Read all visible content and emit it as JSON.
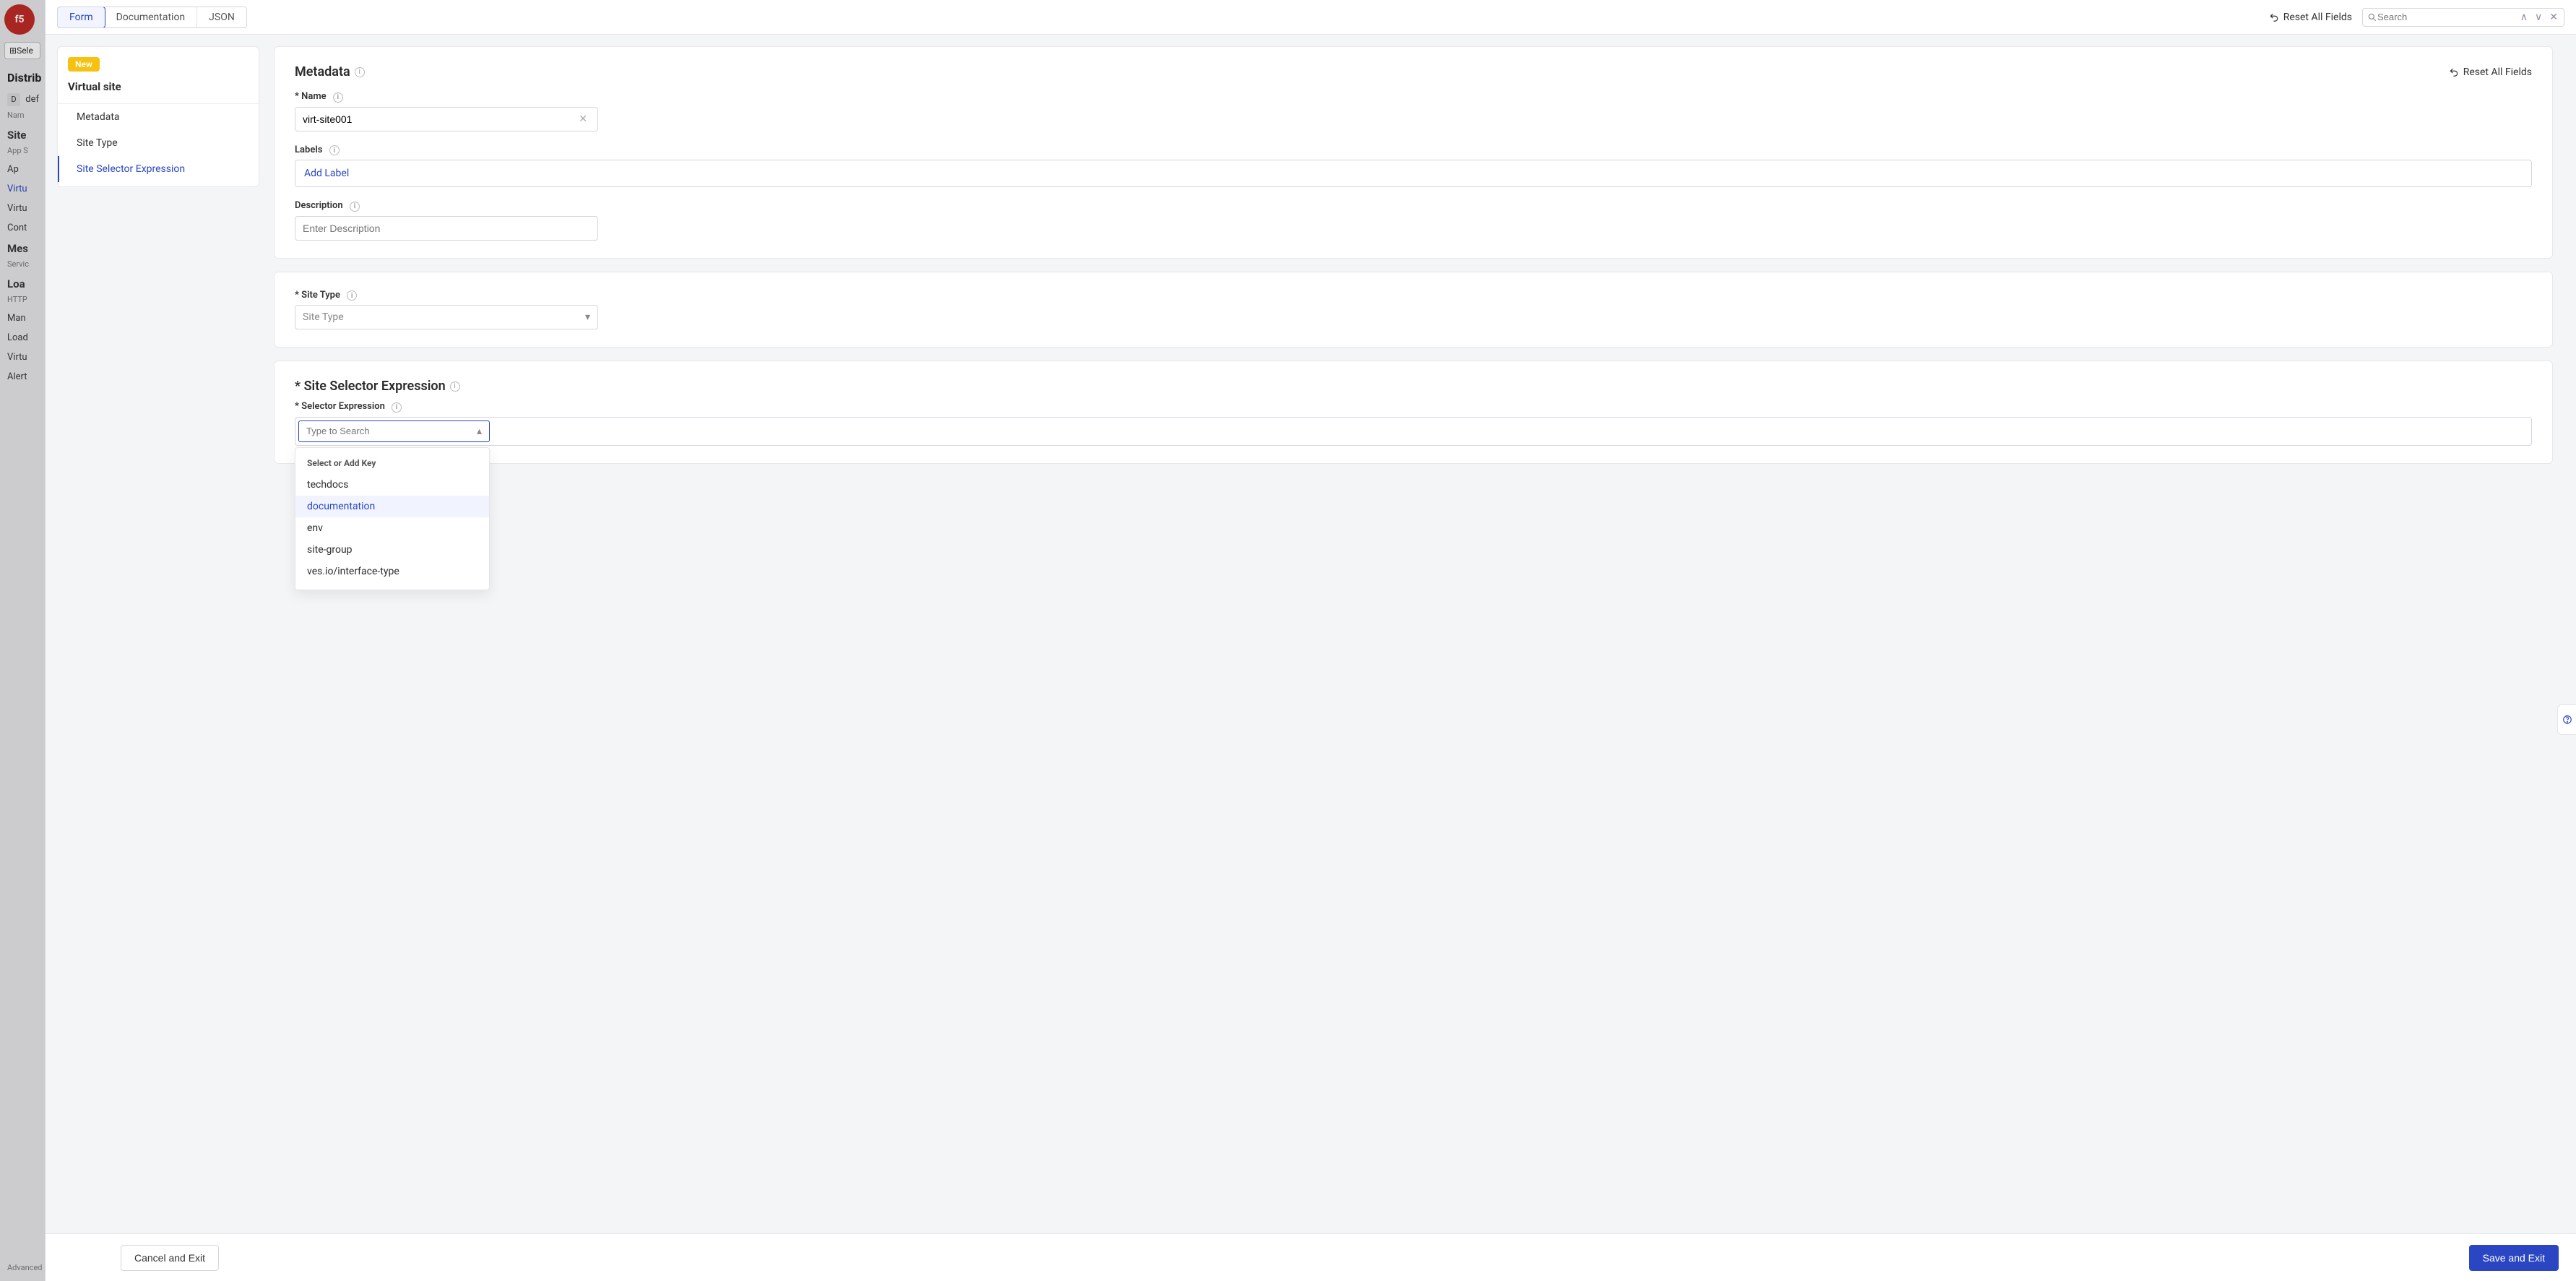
{
  "background_sidebar": {
    "logo_text": "f5",
    "select_button": "Sele",
    "heading": "Distrib",
    "ns_badge": "D",
    "ns_name": "def",
    "ns_sub": "Nam",
    "sections": [
      {
        "title": "Site",
        "sub": "App S"
      },
      {
        "title": "Ap"
      },
      {
        "title": "Virtu",
        "link": true
      },
      {
        "title": "Virtu"
      },
      {
        "title": "Cont"
      },
      {
        "title": "Mes",
        "sub": "Servic"
      },
      {
        "title": "Loa",
        "sub": "HTTP"
      },
      {
        "title": "Man"
      },
      {
        "title": "Load"
      },
      {
        "title": "Virtu"
      },
      {
        "title": "Alert"
      }
    ],
    "advanced": "Advanced"
  },
  "topbar": {
    "tabs": {
      "form": "Form",
      "documentation": "Documentation",
      "json": "JSON"
    },
    "reset": "Reset All Fields",
    "search_placeholder": "Search"
  },
  "nav": {
    "badge": "New",
    "title": "Virtual site",
    "items": [
      {
        "key": "metadata",
        "label": "Metadata"
      },
      {
        "key": "site_type",
        "label": "Site Type"
      },
      {
        "key": "selector",
        "label": "Site Selector Expression",
        "active": true
      }
    ]
  },
  "metadata_card": {
    "title": "Metadata",
    "reset": "Reset All Fields",
    "name": {
      "label": "Name",
      "value": "virt-site001"
    },
    "labels": {
      "label": "Labels",
      "placeholder": "Add Label"
    },
    "description": {
      "label": "Description",
      "placeholder": "Enter Description"
    }
  },
  "site_type_card": {
    "label": "Site Type",
    "placeholder": "Site Type"
  },
  "selector_card": {
    "title": "Site Selector Expression",
    "field_label": "Selector Expression",
    "combo_placeholder": "Type to Search",
    "dropdown_header": "Select or Add Key",
    "options": [
      "techdocs",
      "documentation",
      "env",
      "site-group",
      "ves.io/interface-type"
    ],
    "hovered_index": 1
  },
  "footer": {
    "cancel": "Cancel and Exit",
    "save": "Save and Exit"
  }
}
